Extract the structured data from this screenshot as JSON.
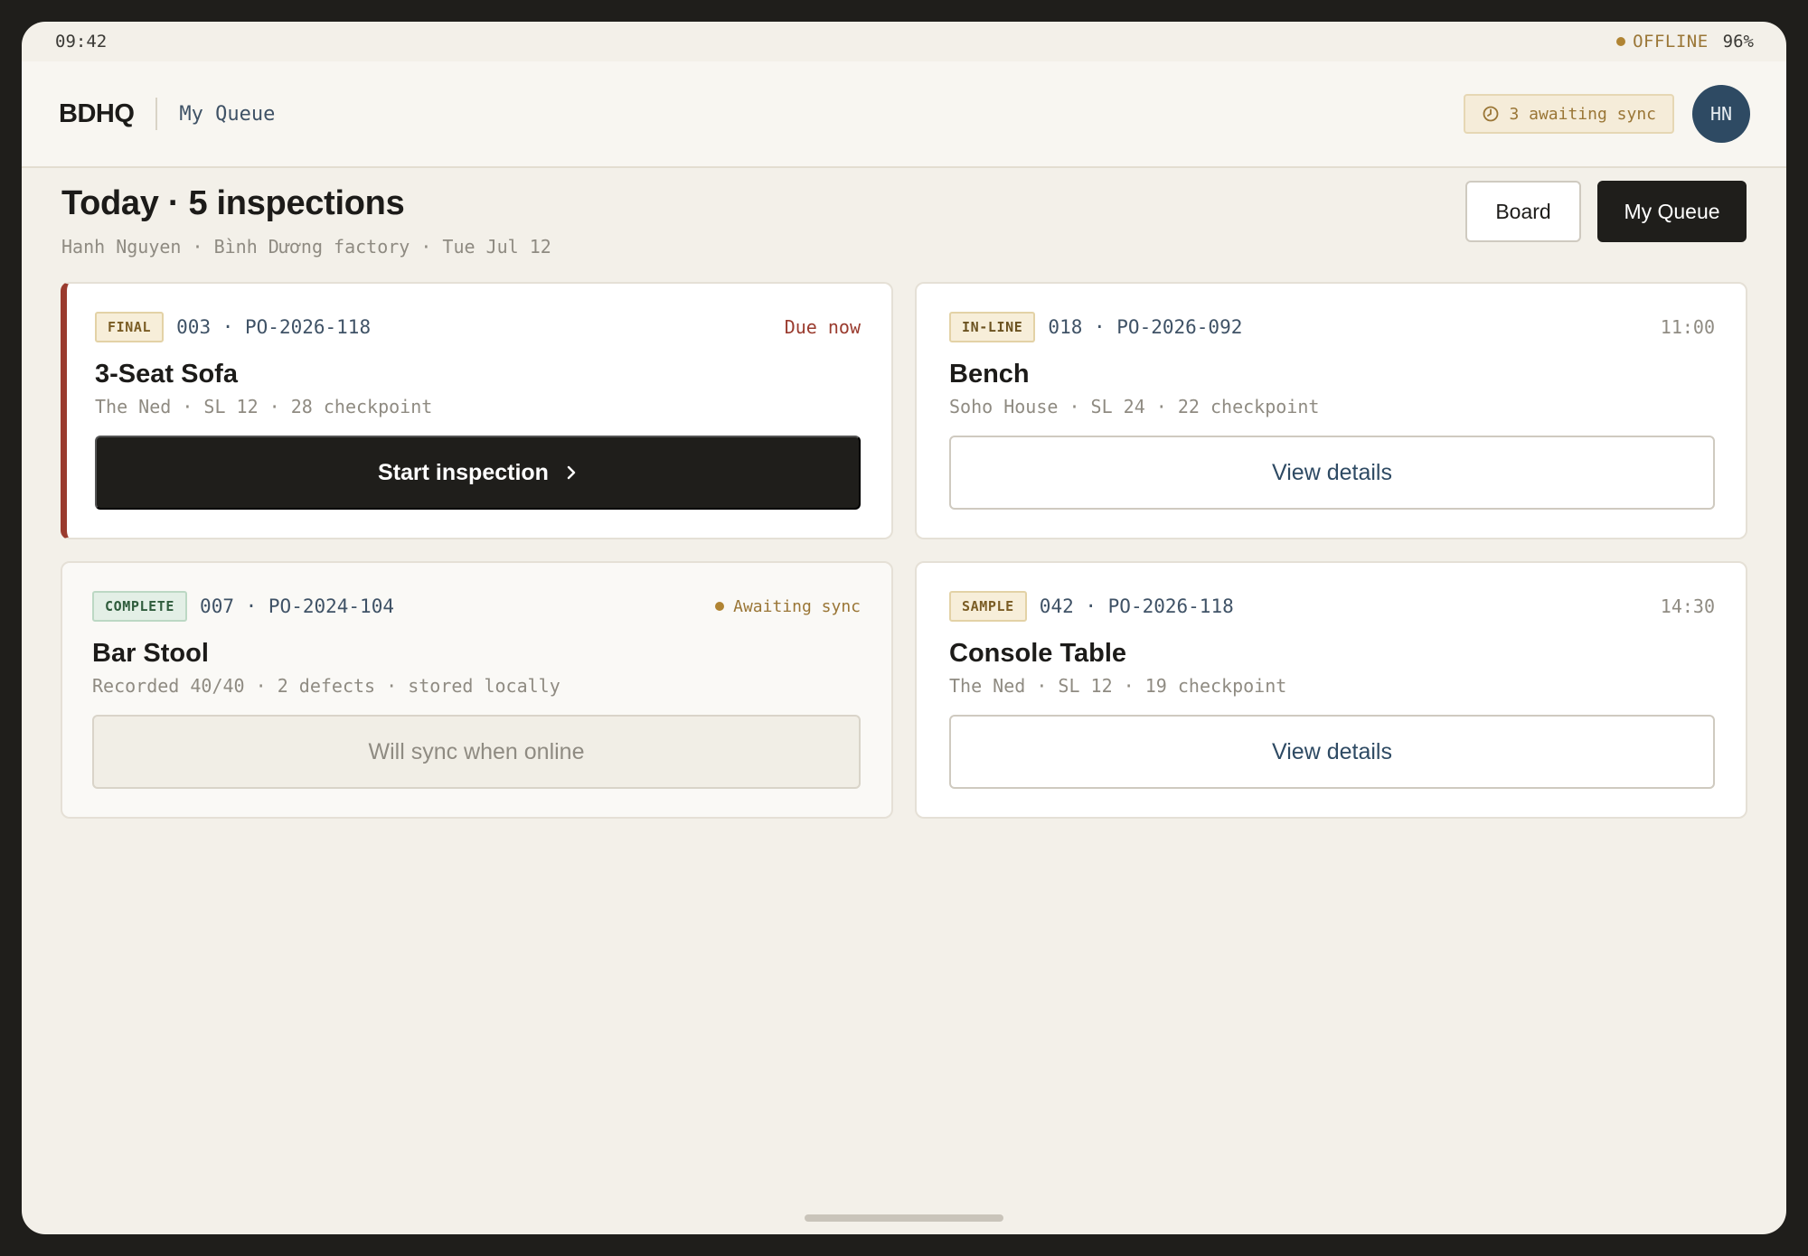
{
  "status_bar": {
    "time": "09:42",
    "network": "OFFLINE",
    "battery": "96%"
  },
  "header": {
    "brand": "BDHQ",
    "section": "My Queue",
    "sync_pill": "3 awaiting sync",
    "avatar_initials": "HN"
  },
  "page": {
    "title": "Today · 5 inspections",
    "meta": "Hanh Nguyen · Bình Dương factory · Tue Jul 12",
    "view_toggle": {
      "board": "Board",
      "my_queue": "My Queue",
      "selected": "My Queue"
    }
  },
  "cards": [
    {
      "tag": "FINAL",
      "ref": "003 · PO-2026-118",
      "time": "Due now",
      "name": "3-Seat Sofa",
      "details": "The Ned · SL 12 · 28 checkpoint",
      "action": "Start inspection"
    },
    {
      "tag": "IN-LINE",
      "ref": "018 · PO-2026-092",
      "time": "11:00",
      "name": "Bench",
      "details": "Soho House · SL 24 · 22 checkpoint",
      "action": "View details"
    },
    {
      "tag": "COMPLETE",
      "ref": "007 · PO-2024-104",
      "status": "Awaiting sync",
      "name": "Bar Stool",
      "details": "Recorded 40/40 · 2 defects · stored locally",
      "action": "Will sync when online"
    },
    {
      "tag": "SAMPLE",
      "ref": "042 · PO-2026-118",
      "time": "14:30",
      "name": "Console Table",
      "details": "The Ned · SL 12 · 19 checkpoint",
      "action": "View details"
    }
  ],
  "colors": {
    "accent_dark": "#1f1e1b",
    "urgent": "#9a3b2e",
    "warning": "#b08433",
    "link_blue": "#2e4a63",
    "background": "#f3f0e9"
  },
  "icons": {
    "sync": "clock-sync-icon",
    "chevron": "chevron-right-icon",
    "offline": "offline-dot-icon"
  }
}
